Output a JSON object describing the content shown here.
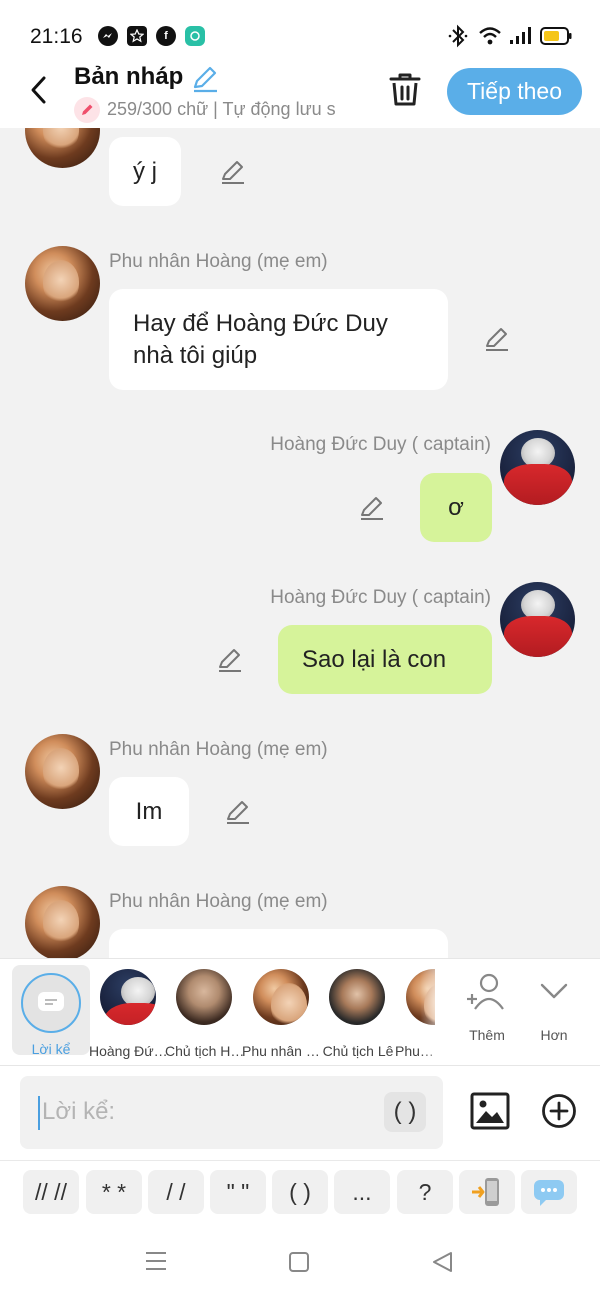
{
  "status_bar": {
    "time": "21:16",
    "apps": [
      "messenger-icon",
      "star-icon",
      "facebook-icon",
      "chat-bubble-icon"
    ]
  },
  "header": {
    "title": "Bản nháp",
    "subtitle": "259/300 chữ | Tự động lưu s",
    "next_label": "Tiếp theo"
  },
  "messages": [
    {
      "side": "left",
      "sender": "",
      "text": "ý j",
      "avatar": "lady"
    },
    {
      "side": "left",
      "sender": "Phu nhân Hoàng (mẹ em)",
      "text": "Hay để Hoàng Đức Duy nhà tôi giúp",
      "avatar": "lady"
    },
    {
      "side": "right",
      "sender": "Hoàng Đức Duy ( captain)",
      "text": "ơ",
      "avatar": "red"
    },
    {
      "side": "right",
      "sender": "Hoàng Đức Duy ( captain)",
      "text": "Sao lại là con",
      "avatar": "red"
    },
    {
      "side": "left",
      "sender": "Phu nhân Hoàng (mẹ em)",
      "text": "Im",
      "avatar": "lady"
    },
    {
      "side": "left",
      "sender": "Phu nhân Hoàng (mẹ em)",
      "text": "",
      "avatar": "lady"
    }
  ],
  "characters": {
    "narrator_label": "Lời kể",
    "items": [
      {
        "name": "Hoàng Đức Duy ( captain)",
        "avatar": "red"
      },
      {
        "name": "Chủ tịch Hoàng",
        "avatar": "man1"
      },
      {
        "name": "Phu nhân Hoàng (mẹ em)",
        "avatar": "lady"
      },
      {
        "name": "Chủ tịch Lê",
        "avatar": "man2"
      },
      {
        "name": "Phu nhân",
        "avatar": "lady"
      }
    ],
    "add_label": "Thêm",
    "more_label": "Hơn"
  },
  "input": {
    "placeholder": "Lời kể:",
    "paren_label": "( )"
  },
  "format_buttons": [
    "// //",
    "* *",
    "/ /",
    "\" \"",
    "( )",
    "...",
    "?"
  ],
  "colors": {
    "accent": "#5aaee8",
    "green_bubble": "#d6f39a",
    "background": "#f2f2f2"
  }
}
